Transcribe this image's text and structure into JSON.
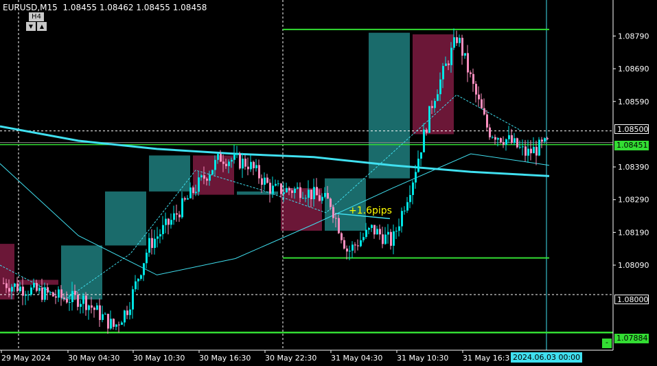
{
  "window": {
    "title": "EURUSD,M15  1.08455 1.08462 1.08455 1.08458",
    "timeframe_label": "H4",
    "down_button": "▼",
    "up_button": "▲"
  },
  "annotation": "+1.6pips",
  "price_tags": {
    "line_1": "1.08500",
    "bid": "1.08451",
    "line_2": "1.08000",
    "low_line": "1.07884"
  },
  "time_tag": "2024.06.03 00:00",
  "minus_button": "-",
  "colors": {
    "background": "#000000",
    "axis": "#ffffff",
    "bull_box": "#1a6b6b",
    "bear_box": "#6b1737",
    "bull_candle": "#00e5e5",
    "bear_candle": "#ff8fc0",
    "ma_slow": "#40e0f0",
    "hline_green": "#33dd33",
    "annotation": "#ffff00",
    "time_tag_bg": "#40e0f0"
  },
  "chart_data": {
    "type": "candlestick",
    "symbol": "EURUSD",
    "timeframe": "M15",
    "ylim": [
      1.0783,
      1.089
    ],
    "y_ticks": [
      "1.08790",
      "1.08690",
      "1.08590",
      "1.08390",
      "1.08290",
      "1.08190",
      "1.08090"
    ],
    "x_ticks": [
      "29 May 2024",
      "30 May 04:30",
      "30 May 10:30",
      "30 May 16:30",
      "30 May 22:30",
      "31 May 04:30",
      "31 May 10:30",
      "31 May 16:3"
    ],
    "horizontal_lines": [
      1.0881,
      1.08458,
      1.08112,
      1.07884
    ],
    "h4_boxes": [
      {
        "open": 1.08155,
        "close": 1.07985,
        "dir": "bear"
      },
      {
        "open": 1.0803,
        "close": 1.08045,
        "dir": "bear"
      },
      {
        "open": 1.07985,
        "close": 1.0815,
        "dir": "bull"
      },
      {
        "open": 1.0815,
        "close": 1.08315,
        "dir": "bull"
      },
      {
        "open": 1.08315,
        "close": 1.08425,
        "dir": "bull"
      },
      {
        "open": 1.08425,
        "close": 1.08305,
        "dir": "bear"
      },
      {
        "open": 1.08305,
        "close": 1.08315,
        "dir": "bull"
      },
      {
        "open": 1.08325,
        "close": 1.08195,
        "dir": "bear"
      },
      {
        "open": 1.08195,
        "close": 1.08355,
        "dir": "bull"
      },
      {
        "open": 1.08355,
        "close": 1.088,
        "dir": "bull"
      },
      {
        "open": 1.08795,
        "close": 1.0849,
        "dir": "bear"
      }
    ],
    "ma_slow": [
      1.08514,
      1.0847,
      1.08445,
      1.0843,
      1.0842,
      1.08395,
      1.08375,
      1.08362
    ],
    "ma_fast": [
      1.084,
      1.0818,
      1.0806,
      1.0811,
      1.08215,
      1.08325,
      1.0843,
      1.08395
    ],
    "ma_dashed": [
      1.0809,
      1.07985,
      1.08125,
      1.0838,
      1.0832,
      1.0825,
      1.0843,
      1.0861,
      1.085
    ]
  }
}
